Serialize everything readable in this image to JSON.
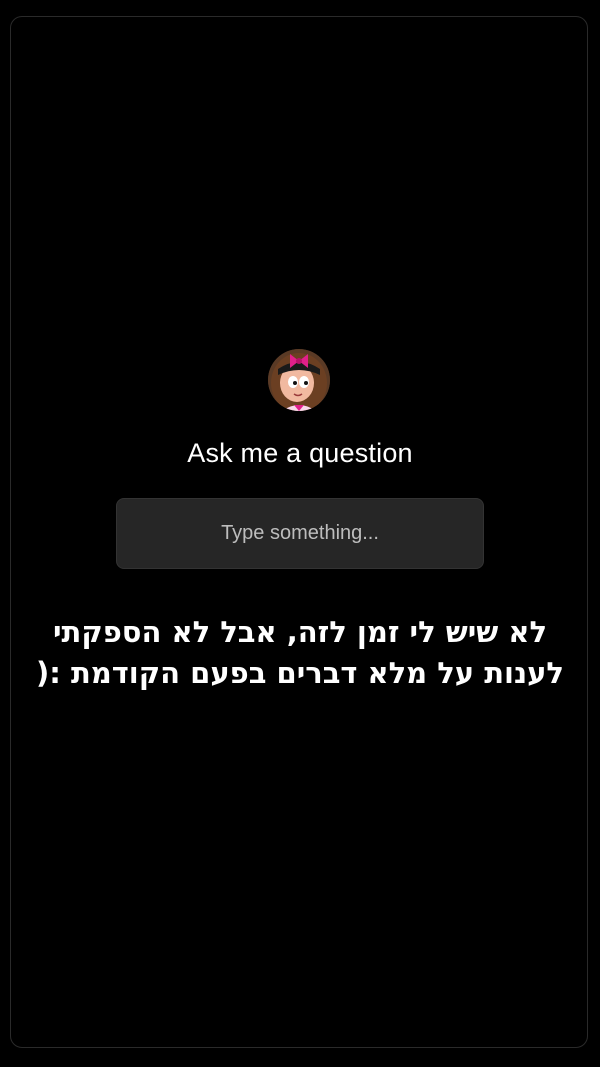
{
  "sticker": {
    "prompt": "Ask me a question",
    "placeholder": "Type something...",
    "avatar_icon": "profile-avatar"
  },
  "caption": {
    "line1": "לא שיש לי זמן לזה, אבל לא הספקתי",
    "line2": "לענות על מלא דברים בפעם הקודמת :("
  },
  "colors": {
    "background": "#000000",
    "field": "#262626",
    "text": "#ffffff",
    "placeholder": "#bdbdbd"
  }
}
